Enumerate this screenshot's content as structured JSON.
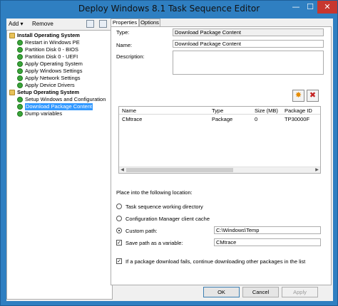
{
  "window": {
    "title": "Deploy Windows 8.1 Task Sequence Editor",
    "minimize": "—",
    "maximize": "☐",
    "close": "✕"
  },
  "toolbar": {
    "add_label": "Add ▾",
    "remove_label": "Remove",
    "up_icon": "move-up-icon",
    "down_icon": "move-down-icon"
  },
  "tree": {
    "items": [
      {
        "label": "Install Operating System",
        "kind": "group",
        "icon": "folder-icon"
      },
      {
        "label": "Restart in Windows PE",
        "kind": "step",
        "icon": "check-icon"
      },
      {
        "label": "Partition Disk 0 - BIOS",
        "kind": "step",
        "icon": "check-icon"
      },
      {
        "label": "Partition Disk 0 - UEFI",
        "kind": "step",
        "icon": "check-icon"
      },
      {
        "label": "Apply Operating System",
        "kind": "step",
        "icon": "check-icon"
      },
      {
        "label": "Apply Windows Settings",
        "kind": "step",
        "icon": "check-icon"
      },
      {
        "label": "Apply Network Settings",
        "kind": "step",
        "icon": "check-icon"
      },
      {
        "label": "Apply Device Drivers",
        "kind": "step",
        "icon": "check-icon"
      },
      {
        "label": "Setup Operating System",
        "kind": "group",
        "icon": "folder-icon"
      },
      {
        "label": "Setup Windows and Configuration",
        "kind": "step",
        "icon": "check-icon"
      },
      {
        "label": "Download Package Content",
        "kind": "step",
        "icon": "check-icon",
        "selected": true
      },
      {
        "label": "Dump variables",
        "kind": "step",
        "icon": "check-icon"
      }
    ]
  },
  "tabs": {
    "properties": "Properties",
    "options": "Options"
  },
  "form": {
    "type_label": "Type:",
    "type_value": "Download Package Content",
    "name_label": "Name:",
    "name_value": "Download Package Content",
    "description_label": "Description:",
    "description_value": ""
  },
  "actions": {
    "add_icon": "starburst-add-icon",
    "add_glyph": "✸",
    "delete_icon": "delete-x-icon",
    "delete_glyph": "✖"
  },
  "packages": {
    "columns": [
      "Name",
      "Type",
      "Size (MB)",
      "Package ID"
    ],
    "rows": [
      [
        "CMtrace",
        "Package",
        "0",
        "TP30000F"
      ]
    ],
    "scroll_left": "◀",
    "scroll_right": "▶"
  },
  "location": {
    "heading": "Place into the following location:",
    "options": [
      {
        "label": "Task sequence working directory",
        "selected": false
      },
      {
        "label": "Configuration Manager client cache",
        "selected": false
      },
      {
        "label": "Custom path:",
        "selected": true
      }
    ],
    "custom_path_value": "C:\\Windows\\Temp",
    "save_var_label": "Save path as a variable:",
    "save_var_checked": true,
    "save_var_value": "CMtrace",
    "continue_label": "If a package download fails, continue downloading other packages in the list",
    "continue_checked": true,
    "check_glyph": "✓"
  },
  "buttons": {
    "ok": "OK",
    "cancel": "Cancel",
    "apply": "Apply"
  },
  "colors": {
    "title_bar": "#2f7fc1",
    "selection": "#3399ff",
    "close_button": "#c7372f"
  }
}
